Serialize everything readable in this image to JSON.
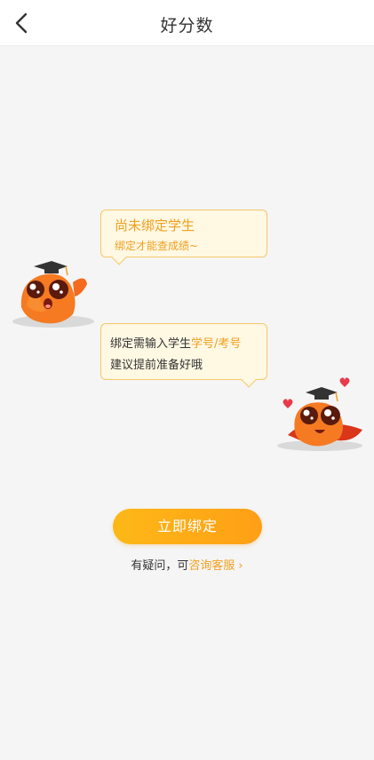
{
  "header": {
    "title": "好分数",
    "back_icon": "chevron-left-icon"
  },
  "bubble1": {
    "line1": "尚未绑定学生",
    "line2": "绑定才能查成绩~"
  },
  "bubble2": {
    "line1_prefix": "绑定需输入学生",
    "line1_highlight": "学号/考号",
    "line2": "建议提前准备好哦"
  },
  "mascots": [
    "graduate-mascot-icon",
    "graduate-mascot-hearts-icon"
  ],
  "actions": {
    "bind_label": "立即绑定"
  },
  "help": {
    "prefix": "有疑问，可",
    "link": "咨询客服",
    "chevron": "›"
  },
  "colors": {
    "accent": "#f0a020",
    "button_start": "#fdb817",
    "button_end": "#ff9f16",
    "bubble_bg": "#fff8e3",
    "bubble_border": "#f5c76a",
    "background": "#f5f5f5"
  }
}
